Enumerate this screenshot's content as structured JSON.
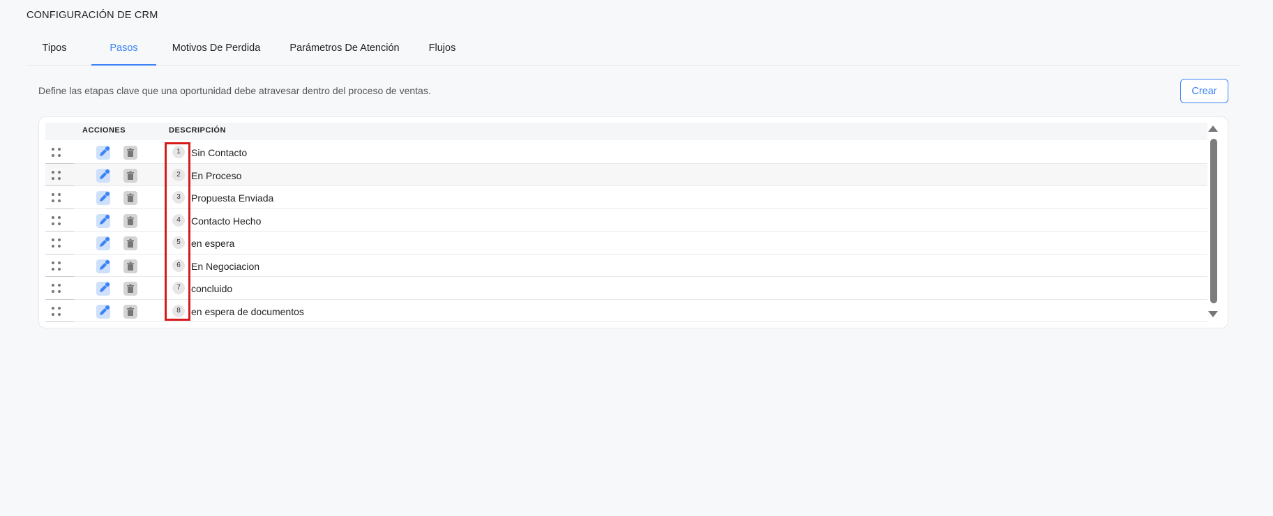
{
  "page": {
    "title": "CONFIGURACIÓN DE CRM"
  },
  "tabs": [
    {
      "label": "Tipos",
      "active": false
    },
    {
      "label": "Pasos",
      "active": true
    },
    {
      "label": "Motivos De Perdida",
      "active": false
    },
    {
      "label": "Parámetros De Atención",
      "active": false
    },
    {
      "label": "Flujos",
      "active": false
    }
  ],
  "section": {
    "description": "Define las etapas clave que una oportunidad debe atravesar dentro del proceso de ventas.",
    "create_label": "Crear"
  },
  "table": {
    "headers": {
      "actions": "ACCIONES",
      "description": "DESCRIPCIÓN"
    },
    "rows": [
      {
        "order": "1",
        "description": "Sin Contacto"
      },
      {
        "order": "2",
        "description": "En Proceso"
      },
      {
        "order": "3",
        "description": "Propuesta Enviada"
      },
      {
        "order": "4",
        "description": "Contacto Hecho"
      },
      {
        "order": "5",
        "description": "en espera"
      },
      {
        "order": "6",
        "description": "En Negociacion"
      },
      {
        "order": "7",
        "description": "concluido"
      },
      {
        "order": "8",
        "description": "en espera de documentos"
      }
    ]
  },
  "icons": {
    "drag": "drag-handle-icon",
    "edit": "pencil-icon",
    "delete": "trash-icon",
    "scroll_up": "triangle-up-icon",
    "scroll_down": "triangle-down-icon"
  },
  "colors": {
    "accent": "#3b82f6",
    "highlight": "#d71a1a",
    "background": "#f7f8fa"
  }
}
